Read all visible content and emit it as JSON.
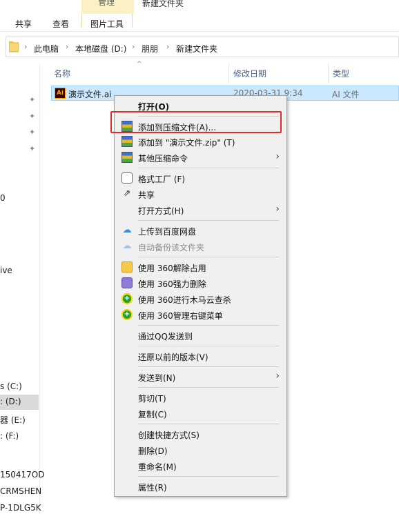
{
  "window": {
    "title": "新建文件夹"
  },
  "ribbon": {
    "context_header": "管理",
    "tabs": [
      "共享",
      "查看",
      "图片工具"
    ]
  },
  "address": {
    "crumbs": [
      "此电脑",
      "本地磁盘 (D:)",
      "朋朋",
      "新建文件夹"
    ]
  },
  "nav_pane": {
    "fragments": [
      "0",
      "ive",
      "s (C:)",
      ": (D:)",
      "器 (E:)",
      ": (F:)",
      "150417OD",
      "CRMSHEN",
      "P-1DLG5K"
    ]
  },
  "columns": {
    "name": "名称",
    "date": "修改日期",
    "type": "类型"
  },
  "file": {
    "name": "演示文件.ai",
    "date": "2020-03-31 9:34",
    "type": "AI 文件",
    "icon_text": "Ai"
  },
  "context_menu": {
    "items": [
      {
        "label": "打开(O)",
        "icon": "none"
      },
      {
        "label": "添加到压缩文件(A)...",
        "icon": "winrar-icon"
      },
      {
        "label": "添加到 \"演示文件.zip\" (T)",
        "icon": "winrar-icon"
      },
      {
        "label": "其他压缩命令",
        "icon": "winrar-icon"
      },
      {
        "label": "格式工厂 (F)",
        "icon": "format-factory-icon"
      },
      {
        "label": "共享",
        "icon": "share-icon"
      },
      {
        "label": "打开方式(H)",
        "icon": "none"
      },
      {
        "label": "上传到百度网盘",
        "icon": "baidu-cloud-icon"
      },
      {
        "label": "自动备份该文件夹",
        "icon": "baidu-cloud-icon"
      },
      {
        "label": "使用 360解除占用",
        "icon": "360-unlock-icon"
      },
      {
        "label": "使用 360强力删除",
        "icon": "360-shred-icon"
      },
      {
        "label": "使用 360进行木马云查杀",
        "icon": "360-scan-icon"
      },
      {
        "label": "使用 360管理右键菜单",
        "icon": "360-scan-icon"
      },
      {
        "label": "通过QQ发送到",
        "icon": "none"
      },
      {
        "label": "还原以前的版本(V)",
        "icon": "none"
      },
      {
        "label": "发送到(N)",
        "icon": "none"
      },
      {
        "label": "剪切(T)",
        "icon": "none"
      },
      {
        "label": "复制(C)",
        "icon": "none"
      },
      {
        "label": "创建快捷方式(S)",
        "icon": "none"
      },
      {
        "label": "删除(D)",
        "icon": "none"
      },
      {
        "label": "重命名(M)",
        "icon": "none"
      },
      {
        "label": "属性(R)",
        "icon": "none"
      }
    ],
    "submenu_arrow": "›"
  },
  "colors": {
    "selection": "#cce8ff",
    "highlight_box": "#e02b2b",
    "menu_bg": "#f0f0f0"
  }
}
